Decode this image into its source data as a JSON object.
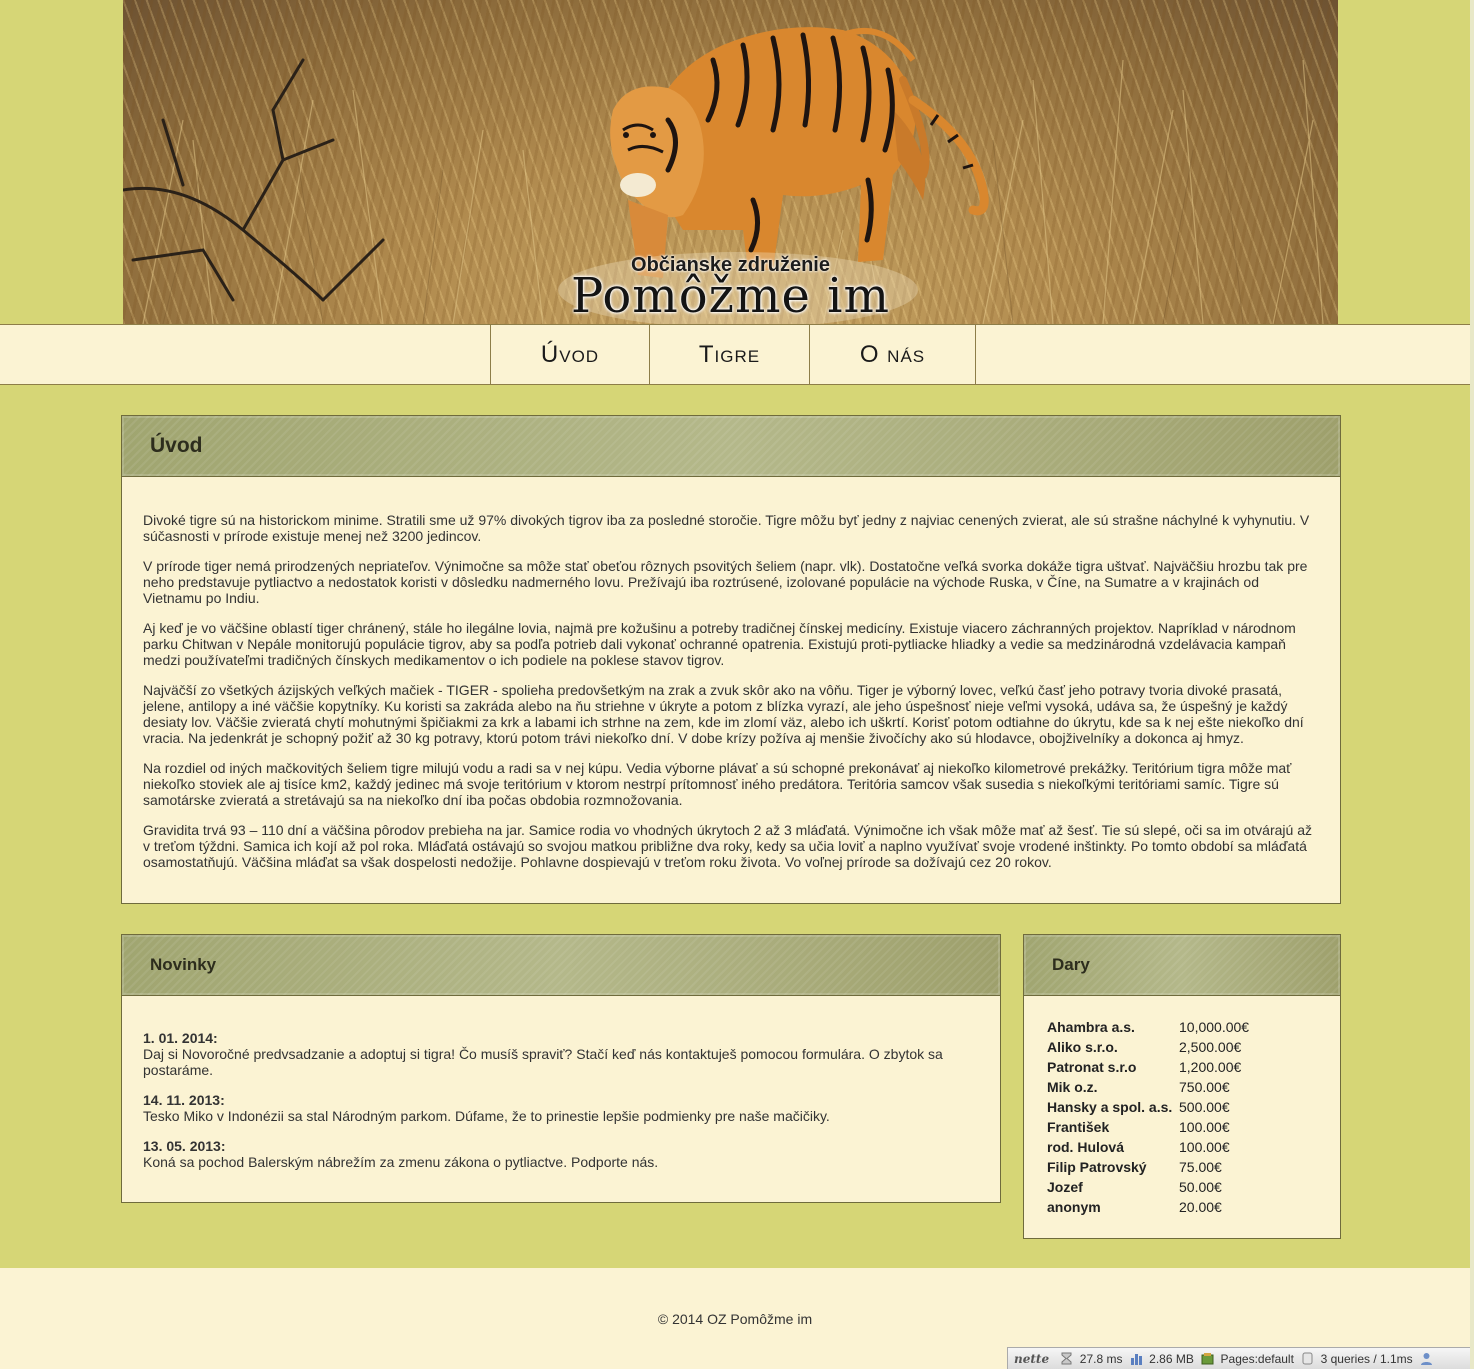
{
  "header": {
    "subtitle": "Občianske združenie",
    "title": "Pomôžme im"
  },
  "nav": {
    "items": [
      {
        "label": "Úvod"
      },
      {
        "label": "Tigre"
      },
      {
        "label": "O nás"
      }
    ]
  },
  "intro": {
    "heading": "Úvod",
    "paragraphs": [
      "Divoké tigre sú na historickom minime. Stratili sme už 97% divokých tigrov iba za posledné storočie. Tigre môžu byť jedny z najviac cenených zvierat, ale sú strašne náchylné k vyhynutiu. V súčasnosti v prírode existuje menej než 3200 jedincov.",
      "V prírode tiger nemá prirodzených nepriateľov. Výnimočne sa môže stať obeťou rôznych psovitých šeliem (napr. vlk). Dostatočne veľká svorka dokáže tigra uštvať. Najväčšiu hrozbu tak pre neho predstavuje pytliactvo a nedostatok koristi v dôsledku nadmerného lovu. Prežívajú iba roztrúsené, izolované populácie na východe Ruska, v Číne, na Sumatre a v krajinách od Vietnamu po Indiu.",
      "Aj keď je vo väčšine oblastí tiger chránený, stále ho ilegálne lovia, najmä pre kožušinu a potreby tradičnej čínskej medicíny. Existuje viacero záchranných projektov. Napríklad v národnom parku Chitwan v Nepále monitorujú populácie tigrov, aby sa podľa potrieb dali vykonať ochranné opatrenia. Existujú proti-pytliacke hliadky a vedie sa medzinárodná vzdelávacia kampaň medzi používateľmi tradičných čínskych medikamentov o ich podiele na poklese stavov tigrov.",
      "Najväčší zo všetkých ázijských veľkých mačiek - TIGER - spolieha predovšetkým na zrak a zvuk skôr ako na vôňu. Tiger je výborný lovec, veľkú časť jeho potravy tvoria divoké prasatá, jelene, antilopy a iné väčšie kopytníky. Ku koristi sa zakráda alebo na ňu striehne v úkryte a potom z blízka vyrazí, ale jeho úspešnosť nieje veľmi vysoká, udáva sa, že úspešný je každý desiaty lov. Väčšie zvieratá chytí mohutnými špičiakmi za krk a labami ich strhne na zem, kde im zlomí väz, alebo ich uškrtí. Korisť potom odtiahne do úkrytu, kde sa k nej ešte niekoľko dní vracia. Na jedenkrát je schopný požiť až 30 kg potravy, ktorú potom trávi niekoľko dní. V dobe krízy požíva aj menšie živočíchy ako sú hlodavce, obojživelníky a dokonca aj hmyz.",
      "Na rozdiel od iných mačkovitých šeliem tigre milujú vodu a radi sa v nej kúpu. Vedia výborne plávať a sú schopné prekonávať aj niekoľko kilometrové prekážky. Teritórium tigra môže mať niekoľko stoviek ale aj tisíce km2, každý jedinec má svoje teritórium v ktorom nestrpí prítomnosť iného predátora. Teritória samcov však susedia s niekoľkými teritóriami samíc. Tigre sú samotárske zvieratá a stretávajú sa na niekoľko dní iba počas obdobia rozmnožovania.",
      "Gravidita trvá 93 – 110 dní a väčšina pôrodov prebieha na jar. Samice rodia vo vhodných úkrytoch 2 až 3 mláďatá. Výnimočne ich však môže mať až šesť. Tie sú slepé, oči sa im otvárajú až v treťom týždni. Samica ich kojí až pol roka. Mláďatá ostávajú so svojou matkou približne dva roky, kedy sa učia loviť a naplno využívať svoje vrodené inštinkty. Po tomto období sa mláďatá osamostatňujú. Väčšina mláďat sa však dospelosti nedožije. Pohlavne dospievajú v treťom roku života. Vo voľnej prírode sa dožívajú cez 20 rokov."
    ]
  },
  "news": {
    "heading": "Novinky",
    "items": [
      {
        "date": "1. 01. 2014:",
        "text": "Daj si Novoročné predvsadzanie a adoptuj si tigra! Čo musíš spraviť? Stačí keď nás kontaktuješ pomocou formulára. O zbytok sa postaráme."
      },
      {
        "date": "14. 11. 2013:",
        "text": "Tesko Miko v Indonézii sa stal Národným parkom. Dúfame, že to prinestie lepšie podmienky pre naše mačičiky."
      },
      {
        "date": "13. 05. 2013:",
        "text": "Koná sa pochod Balerským nábrežím za zmenu zákona o pytliactve. Podporte nás."
      }
    ]
  },
  "donations": {
    "heading": "Dary",
    "rows": [
      {
        "name": "Ahambra a.s.",
        "amount": "10,000.00€"
      },
      {
        "name": "Aliko s.r.o.",
        "amount": "2,500.00€"
      },
      {
        "name": "Patronat s.r.o",
        "amount": "1,200.00€"
      },
      {
        "name": "Mik o.z.",
        "amount": "750.00€"
      },
      {
        "name": "Hansky a spol. a.s.",
        "amount": "500.00€"
      },
      {
        "name": "František",
        "amount": "100.00€"
      },
      {
        "name": "rod. Hulová",
        "amount": "100.00€"
      },
      {
        "name": "Filip Patrovský",
        "amount": "75.00€"
      },
      {
        "name": "Jozef",
        "amount": "50.00€"
      },
      {
        "name": "anonym",
        "amount": "20.00€"
      }
    ]
  },
  "footer": {
    "copyright": "© 2014 OZ Pomôžme im"
  },
  "debug_bar": {
    "logo": "nette",
    "time": "27.8 ms",
    "memory": "2.86 MB",
    "presenter": "Pages:default",
    "queries": "3 queries / 1.1ms"
  },
  "colors": {
    "page_bg": "#d6d676",
    "panel_bg": "#fbf3d3",
    "panel_head": "#a8ac78",
    "border": "#6f6b3c"
  }
}
